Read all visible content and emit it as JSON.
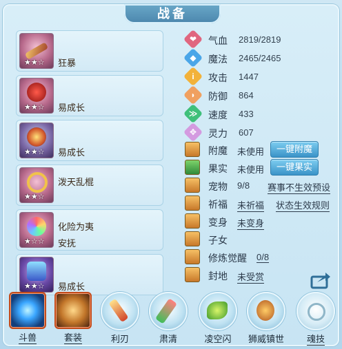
{
  "window": {
    "title": "战备"
  },
  "equipment": [
    {
      "name_lines": [
        "狂暴"
      ],
      "stars": "★★☆",
      "icon": "crossbow-icon"
    },
    {
      "name_lines": [
        "",
        "易成长"
      ],
      "stars": "★★☆",
      "icon": "red-gem-icon"
    },
    {
      "name_lines": [
        "",
        "易成长"
      ],
      "stars": "★★☆",
      "icon": "mech-eye-icon"
    },
    {
      "name_lines": [
        "泼天乱棍"
      ],
      "stars": "★★☆",
      "icon": "gold-chain-icon"
    },
    {
      "name_lines": [
        "化险为夷",
        "安抚"
      ],
      "stars": "★☆☆",
      "icon": "rainbow-ring-icon"
    },
    {
      "name_lines": [
        "",
        "易成长"
      ],
      "stars": "★★☆",
      "icon": "purple-armor-icon"
    }
  ],
  "stats": [
    {
      "label": "气血",
      "value": "2819/2819",
      "color": "#e0667f",
      "icon": "heart-icon",
      "glyph": "❤"
    },
    {
      "label": "魔法",
      "value": "2465/2465",
      "color": "#4aa6e8",
      "icon": "mana-icon",
      "glyph": "◆"
    },
    {
      "label": "攻击",
      "value": "1447",
      "color": "#f2b23a",
      "icon": "attack-icon",
      "glyph": "i"
    },
    {
      "label": "防御",
      "value": "864",
      "color": "#f0a060",
      "icon": "shield-icon",
      "glyph": "◗"
    },
    {
      "label": "速度",
      "value": "433",
      "color": "#3fc07a",
      "icon": "speed-icon",
      "glyph": "≫"
    },
    {
      "label": "灵力",
      "value": "607",
      "color": "#d49ae0",
      "icon": "spirit-icon",
      "glyph": "✥"
    }
  ],
  "extras": {
    "enchant": {
      "label": "附魔",
      "value": "未使用",
      "button": "一键附魔"
    },
    "fruit": {
      "label": "果实",
      "value": "未使用",
      "button": "一键果实"
    },
    "pet": {
      "label": "宠物",
      "value": "9/8",
      "link": "赛事不生效预设"
    },
    "blessing": {
      "label": "祈福",
      "value": "未祈福",
      "link": "状态生效规则"
    },
    "transform": {
      "label": "变身",
      "value": "未变身"
    },
    "child": {
      "label": "子女"
    },
    "cultivation": {
      "label": "修炼觉醒",
      "value": "0/8"
    },
    "fief": {
      "label": "封地",
      "value": "未受赏"
    }
  },
  "bottom_tabs": [
    {
      "label": "斗兽",
      "icon": "beast-orb-icon",
      "style": "square-blue"
    },
    {
      "label": "套装",
      "icon": "armor-set-icon",
      "style": "square-gold"
    },
    {
      "label": "利刃",
      "icon": "blade-icon",
      "style": "orb"
    },
    {
      "label": "肃清",
      "icon": "purge-icon",
      "style": "orb"
    },
    {
      "label": "凌空闪",
      "icon": "dash-icon",
      "style": "orb"
    },
    {
      "label": "狮威镇世",
      "icon": "lion-icon",
      "style": "orb"
    },
    {
      "label": "魂技",
      "icon": "soul-skill-icon",
      "style": "orb"
    }
  ]
}
